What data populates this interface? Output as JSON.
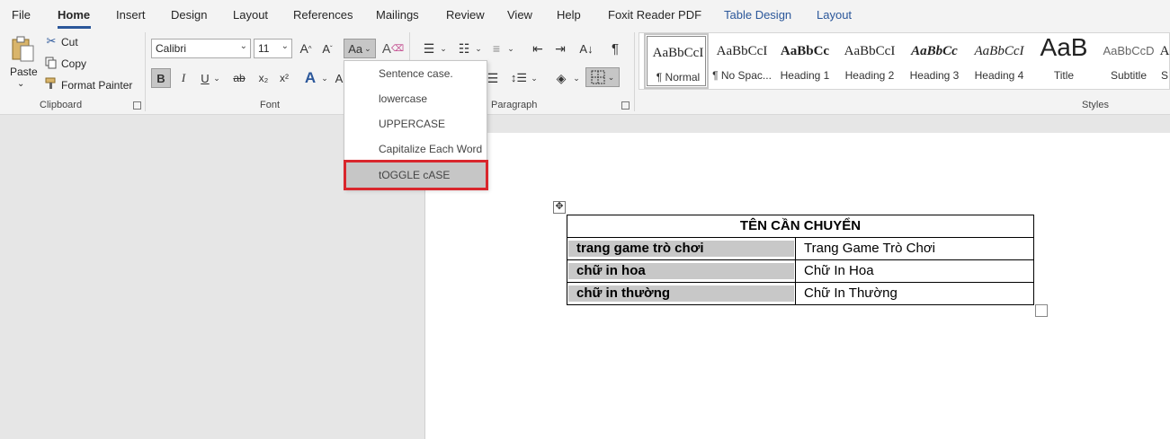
{
  "menu": {
    "tabs": [
      "File",
      "Home",
      "Insert",
      "Design",
      "Layout",
      "References",
      "Mailings",
      "Review",
      "View",
      "Help",
      "Foxit Reader PDF",
      "Table Design",
      "Layout"
    ],
    "active_tab": "Home"
  },
  "clipboard": {
    "paste_label": "Paste",
    "cut_label": "Cut",
    "copy_label": "Copy",
    "format_painter_label": "Format Painter",
    "group_label": "Clipboard"
  },
  "font": {
    "font_name": "Calibri",
    "font_size": "11",
    "change_case_label": "Aa",
    "group_label": "Font",
    "bold": "B",
    "italic": "I",
    "underline": "U",
    "strike": "ab",
    "subscript": "x₂",
    "superscript": "x²"
  },
  "paragraph": {
    "group_label": "Paragraph"
  },
  "styles": {
    "group_label": "Styles",
    "items": [
      {
        "sample": "AaBbCcI",
        "name": "¶ Normal"
      },
      {
        "sample": "AaBbCcI",
        "name": "¶ No Spac..."
      },
      {
        "sample": "AaBbCc",
        "name": "Heading 1"
      },
      {
        "sample": "AaBbCcI",
        "name": "Heading 2"
      },
      {
        "sample": "AaBbCc",
        "name": "Heading 3"
      },
      {
        "sample": "AaBbCcI",
        "name": "Heading 4"
      },
      {
        "sample": "AaB",
        "name": "Title"
      },
      {
        "sample": "AaBbCcD",
        "name": "Subtitle"
      },
      {
        "sample": "A",
        "name": "S"
      }
    ]
  },
  "change_case_menu": {
    "items": [
      "Sentence case.",
      "lowercase",
      "UPPERCASE",
      "Capitalize Each Word",
      "tOGGLE cASE"
    ],
    "highlighted": "tOGGLE cASE"
  },
  "table": {
    "header": "TÊN CẦN CHUYỂN",
    "rows": [
      {
        "left": "trang game trò chơi",
        "right": "Trang Game Trò Chơi"
      },
      {
        "left": "chữ in hoa",
        "right": "Chữ In Hoa"
      },
      {
        "left": "chữ in thường",
        "right": "Chữ In Thường"
      }
    ]
  },
  "colors": {
    "accent": "#2b579a",
    "highlight_box": "#d9262c",
    "cell_shading": "#c8c8c8"
  }
}
